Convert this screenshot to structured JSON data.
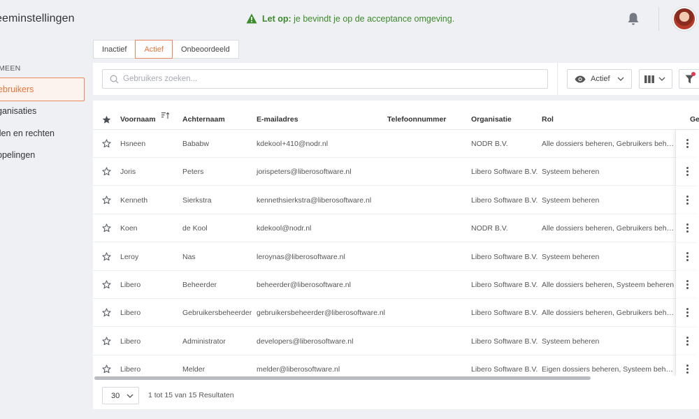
{
  "app": {
    "title": "eeminstellingen"
  },
  "env_warning": {
    "bold": "Let op:",
    "text": "je bevindt je op de acceptance omgeving."
  },
  "colors": {
    "accent": "#e8743b",
    "warning": "#3d8a2a"
  },
  "sidebar": {
    "section": "MEEN",
    "items": [
      {
        "label": "ebruikers",
        "active": true
      },
      {
        "label": "ganisaties",
        "active": false
      },
      {
        "label": "llen en rechten",
        "active": false
      },
      {
        "label": "ppelingen",
        "active": false
      }
    ]
  },
  "tabs": [
    {
      "label": "Inactief"
    },
    {
      "label": "Actief"
    },
    {
      "label": "Onbeoordeeld"
    }
  ],
  "toolbar": {
    "search_placeholder": "Gebruikers zoeken...",
    "view_label": "Actief"
  },
  "table": {
    "headers": {
      "voornaam": "Voornaam",
      "achternaam": "Achternaam",
      "email": "E-mailadres",
      "telefoon": "Telefoonnummer",
      "organisatie": "Organisatie",
      "rol": "Rol",
      "extra": "Ge"
    },
    "rows": [
      {
        "voornaam": "Hsneen",
        "achternaam": "Bababw",
        "email": "kdekool+410@nodr.nl",
        "telefoon": "",
        "organisatie": "NODR B.V.",
        "rol": "Alle dossiers beheren, Gebruikers beheren, ..."
      },
      {
        "voornaam": "Joris",
        "achternaam": "Peters",
        "email": "jorispeters@liberosoftware.nl",
        "telefoon": "",
        "organisatie": "Libero Software B.V.",
        "rol": "Systeem beheren"
      },
      {
        "voornaam": "Kenneth",
        "achternaam": "Sierkstra",
        "email": "kennethsierkstra@liberosoftware.nl",
        "telefoon": "",
        "organisatie": "Libero Software B.V.",
        "rol": "Systeem beheren"
      },
      {
        "voornaam": "Koen",
        "achternaam": "de Kool",
        "email": "kdekool@nodr.nl",
        "telefoon": "",
        "organisatie": "NODR B.V.",
        "rol": "Alle dossiers beheren, Gebruikers beheren, ..."
      },
      {
        "voornaam": "Leroy",
        "achternaam": "Nas",
        "email": "leroynas@liberosoftware.nl",
        "telefoon": "",
        "organisatie": "Libero Software B.V.",
        "rol": "Systeem beheren"
      },
      {
        "voornaam": "Libero",
        "achternaam": "Beheerder",
        "email": "beheerder@liberosoftware.nl",
        "telefoon": "",
        "organisatie": "Libero Software B.V.",
        "rol": "Alle dossiers beheren, Systeem beheren"
      },
      {
        "voornaam": "Libero",
        "achternaam": "Gebruikersbeheerder",
        "email": "gebruikersbeheerder@liberosoftware.nl",
        "telefoon": "",
        "organisatie": "Libero Software B.V.",
        "rol": "Alle dossiers beheren, Gebruikers beheren, ..."
      },
      {
        "voornaam": "Libero",
        "achternaam": "Administrator",
        "email": "developers@liberosoftware.nl",
        "telefoon": "",
        "organisatie": "Libero Software B.V.",
        "rol": "Systeem beheren"
      },
      {
        "voornaam": "Libero",
        "achternaam": "Melder",
        "email": "melder@liberosoftware.nl",
        "telefoon": "",
        "organisatie": "Libero Software B.V.",
        "rol": "Eigen dossiers beheren, Systeem beheren"
      }
    ]
  },
  "pagination": {
    "per_page": "30",
    "result_text": "1 tot 15 van 15 Resultaten"
  }
}
